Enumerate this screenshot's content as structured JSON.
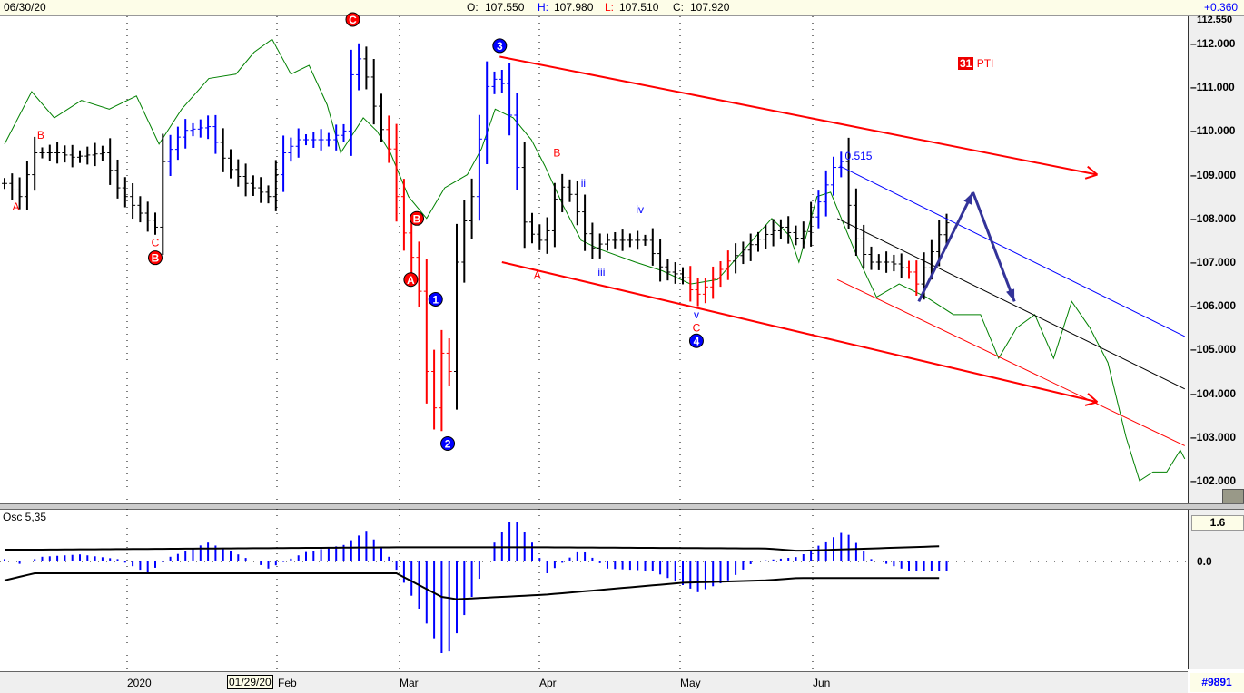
{
  "header": {
    "date": "06/30/20",
    "open_label": "O:",
    "open": "107.550",
    "high_label": "H:",
    "high": "107.980",
    "low_label": "L:",
    "low": "107.510",
    "close_label": "C:",
    "close": "107.920",
    "change": "+0.360"
  },
  "price_axis": {
    "top_label": "112.550",
    "ticks": [
      "112.000",
      "111.000",
      "110.000",
      "109.000",
      "108.000",
      "107.000",
      "106.000",
      "105.000",
      "104.000",
      "103.000",
      "102.000"
    ]
  },
  "osc": {
    "title": "Osc 5,35",
    "top_label": "1.6",
    "zero_label": "0.0"
  },
  "x_axis": {
    "labels": [
      "2020",
      "01/29/20",
      "Feb",
      "Mar",
      "Apr",
      "May",
      "Jun"
    ],
    "footer": "#9891"
  },
  "badge": {
    "number": "31",
    "text": "PTI"
  },
  "colors": {
    "up_bar": "#000000",
    "blue": "#0000ff",
    "red": "#ff0000",
    "green": "#008000",
    "arrow": "#333399"
  },
  "chart_data": {
    "type": "ohlc",
    "ylim": [
      101.6,
      112.55
    ],
    "xlabel": "",
    "ylabel": "",
    "price_keypoints": [
      [
        0,
        108.8
      ],
      [
        2,
        108.5
      ],
      [
        4,
        109.5
      ],
      [
        7,
        109.5
      ],
      [
        9,
        109.4
      ],
      [
        13,
        109.5
      ],
      [
        15,
        108.7
      ],
      [
        17.5,
        108.2
      ],
      [
        20,
        107.8
      ],
      [
        21,
        109.3
      ],
      [
        23.5,
        110
      ],
      [
        27,
        110.1
      ],
      [
        29.5,
        109.2
      ],
      [
        32,
        108.8
      ],
      [
        35,
        108.5
      ],
      [
        37,
        109.5
      ],
      [
        39,
        109.8
      ],
      [
        43,
        109.8
      ],
      [
        45,
        110
      ],
      [
        46.4,
        111.8
      ],
      [
        47.6,
        111.5
      ],
      [
        49.4,
        110.3
      ],
      [
        51.2,
        109.5
      ],
      [
        52.4,
        108
      ],
      [
        54.2,
        107
      ],
      [
        55.4,
        106
      ],
      [
        56.6,
        103
      ],
      [
        57.8,
        105
      ],
      [
        59,
        104.5
      ],
      [
        60.2,
        107.5
      ],
      [
        62,
        108.5
      ],
      [
        63.9,
        111
      ],
      [
        65.7,
        111.3
      ],
      [
        67.5,
        110
      ],
      [
        68.7,
        108
      ],
      [
        70.5,
        107.5
      ],
      [
        71.7,
        107.5
      ],
      [
        73.5,
        108.8
      ],
      [
        75.3,
        108.5
      ],
      [
        77.7,
        107.3
      ],
      [
        80,
        107.5
      ],
      [
        82.5,
        107.5
      ],
      [
        85,
        107.5
      ],
      [
        87.3,
        106.8
      ],
      [
        89.8,
        106.7
      ],
      [
        91.6,
        106.2
      ],
      [
        93.4,
        106.5
      ],
      [
        95.8,
        107
      ],
      [
        98.2,
        107.3
      ],
      [
        100.6,
        107.6
      ],
      [
        103,
        107.8
      ],
      [
        105.4,
        107.5
      ],
      [
        107.8,
        108.3
      ],
      [
        109.6,
        109
      ],
      [
        110.8,
        109.5
      ],
      [
        112,
        108.3
      ],
      [
        113.3,
        107.3
      ],
      [
        115,
        107
      ],
      [
        117.5,
        107
      ],
      [
        119.9,
        106.8
      ],
      [
        121,
        106.5
      ],
      [
        122.9,
        107.2
      ],
      [
        124.7,
        107.9
      ]
    ],
    "blue_ranges": [
      [
        22,
        28
      ],
      [
        37,
        47
      ],
      [
        63,
        68
      ],
      [
        108,
        111
      ]
    ],
    "red_ranges": [
      [
        51,
        59
      ],
      [
        91,
        96
      ],
      [
        120,
        121
      ]
    ],
    "ma_line": [
      [
        0,
        109.7
      ],
      [
        3.6,
        110.9
      ],
      [
        6.6,
        110.3
      ],
      [
        10.2,
        110.7
      ],
      [
        13.9,
        110.5
      ],
      [
        17.5,
        110.8
      ],
      [
        20.5,
        109.7
      ],
      [
        23.5,
        110.5
      ],
      [
        27.1,
        111.2
      ],
      [
        30.7,
        111.3
      ],
      [
        33.1,
        111.8
      ],
      [
        35.5,
        112.1
      ],
      [
        38,
        111.3
      ],
      [
        40.4,
        111.5
      ],
      [
        42.8,
        110.6
      ],
      [
        44.6,
        109.5
      ],
      [
        47.6,
        110.3
      ],
      [
        49.4,
        110
      ],
      [
        51.2,
        109.5
      ],
      [
        53.6,
        108.5
      ],
      [
        56,
        108
      ],
      [
        58.4,
        108.7
      ],
      [
        61.4,
        109
      ],
      [
        63.3,
        109.6
      ],
      [
        65.1,
        110.5
      ],
      [
        67.5,
        110.3
      ],
      [
        69.9,
        109.8
      ],
      [
        71.7,
        109.2
      ],
      [
        74.1,
        108.3
      ],
      [
        76.5,
        107.5
      ],
      [
        78.9,
        107.3
      ],
      [
        83.7,
        107
      ],
      [
        87.3,
        106.8
      ],
      [
        91,
        106.5
      ],
      [
        94.6,
        106.6
      ],
      [
        98.2,
        107.3
      ],
      [
        101.8,
        108
      ],
      [
        104.2,
        107.6
      ],
      [
        105.4,
        107
      ],
      [
        107.8,
        108.5
      ],
      [
        109.6,
        108.6
      ],
      [
        112.7,
        107.3
      ],
      [
        115.7,
        106.2
      ],
      [
        118.7,
        106.5
      ],
      [
        122.3,
        106.2
      ],
      [
        125.9,
        105.8
      ],
      [
        129.5,
        105.8
      ],
      [
        131.9,
        104.8
      ],
      [
        134.3,
        105.5
      ],
      [
        136.7,
        105.8
      ],
      [
        139.2,
        104.8
      ],
      [
        141.6,
        106.1
      ],
      [
        144,
        105.5
      ],
      [
        146.4,
        104.7
      ],
      [
        148.8,
        103
      ],
      [
        150.6,
        102
      ],
      [
        152.4,
        102.2
      ],
      [
        154.2,
        102.2
      ],
      [
        156,
        102.7
      ],
      [
        156.6,
        102.5
      ]
    ],
    "trendlines": [
      {
        "name": "upper-channel",
        "color": "#ff0000",
        "from": [
          65.7,
          111.7
        ],
        "to": [
          145,
          109.0
        ],
        "arrow": true
      },
      {
        "name": "lower-channel",
        "color": "#ff0000",
        "from": [
          66,
          107.0
        ],
        "to": [
          145,
          103.8
        ],
        "arrow": true
      },
      {
        "name": "blue-line",
        "color": "#0000ff",
        "from": [
          110.8,
          109.2
        ],
        "to": [
          156.6,
          105.3
        ]
      },
      {
        "name": "black-line",
        "color": "#000000",
        "from": [
          110.5,
          108.0
        ],
        "to": [
          156.6,
          104.1
        ]
      },
      {
        "name": "thin-red-line",
        "color": "#ff0000",
        "from": [
          110.5,
          106.6
        ],
        "to": [
          156.6,
          102.8
        ]
      }
    ],
    "projection": [
      [
        121.3,
        106.1
      ],
      [
        128.5,
        108.6
      ],
      [
        134,
        106.1
      ]
    ],
    "annotations": [
      {
        "t": "A",
        "d": 1.5,
        "p": 108.27,
        "c": "red",
        "circle": false
      },
      {
        "t": "B",
        "d": 4.8,
        "p": 109.9,
        "c": "red",
        "circle": false
      },
      {
        "t": "C",
        "d": 20,
        "p": 107.45,
        "c": "red",
        "circle": false
      },
      {
        "t": "B",
        "d": 20,
        "p": 107.1,
        "c": "red",
        "circle": true
      },
      {
        "t": "C",
        "d": 46.2,
        "p": 112.55,
        "c": "red",
        "circle": true
      },
      {
        "t": "B",
        "d": 54.7,
        "p": 108.0,
        "c": "red",
        "circle": true
      },
      {
        "t": "A",
        "d": 53.9,
        "p": 106.6,
        "c": "red",
        "circle": true
      },
      {
        "t": "1",
        "d": 57.2,
        "p": 106.15,
        "c": "blue",
        "circle": true
      },
      {
        "t": "2",
        "d": 58.8,
        "p": 102.85,
        "c": "blue",
        "circle": true
      },
      {
        "t": "3",
        "d": 65.7,
        "p": 111.95,
        "c": "blue",
        "circle": true
      },
      {
        "t": "A",
        "d": 70.7,
        "p": 106.7,
        "c": "red",
        "circle": false
      },
      {
        "t": "B",
        "d": 73.3,
        "p": 109.5,
        "c": "red",
        "circle": false
      },
      {
        "t": "ii",
        "d": 76.8,
        "p": 108.8,
        "c": "blue",
        "circle": false
      },
      {
        "t": "iii",
        "d": 79.2,
        "p": 106.77,
        "c": "blue",
        "circle": false
      },
      {
        "t": "iv",
        "d": 84.3,
        "p": 108.2,
        "c": "blue",
        "circle": false
      },
      {
        "t": "v",
        "d": 91.8,
        "p": 105.8,
        "c": "blue",
        "circle": false
      },
      {
        "t": "C",
        "d": 91.8,
        "p": 105.5,
        "c": "red",
        "circle": false
      },
      {
        "t": "4",
        "d": 91.8,
        "p": 105.2,
        "c": "blue",
        "circle": true
      },
      {
        "t": "0.515",
        "d": 111.5,
        "p": 109.43,
        "c": "blue",
        "circle": false
      }
    ],
    "osc_hist": [
      [
        0,
        0.1
      ],
      [
        2,
        -0.1
      ],
      [
        5,
        0.2
      ],
      [
        10,
        0.3
      ],
      [
        15,
        0.1
      ],
      [
        19,
        -0.5
      ],
      [
        22,
        0.2
      ],
      [
        27,
        0.8
      ],
      [
        31,
        0.3
      ],
      [
        35,
        -0.3
      ],
      [
        40,
        0.4
      ],
      [
        45,
        0.7
      ],
      [
        48,
        1.3
      ],
      [
        51,
        0.2
      ],
      [
        55,
        -2
      ],
      [
        58.5,
        -4.2
      ],
      [
        62,
        -1.5
      ],
      [
        65,
        0.8
      ],
      [
        67.5,
        1.9
      ],
      [
        70,
        0.8
      ],
      [
        72,
        -0.5
      ],
      [
        76.5,
        0.5
      ],
      [
        80,
        -0.3
      ],
      [
        86,
        -0.4
      ],
      [
        92,
        -1.3
      ],
      [
        96,
        -0.8
      ],
      [
        99.5,
        0
      ],
      [
        105.4,
        0.2
      ],
      [
        111.5,
        1.3
      ],
      [
        115,
        0.1
      ],
      [
        120,
        -0.4
      ],
      [
        124.7,
        -0.4
      ]
    ],
    "osc_upper": [
      [
        0,
        0.5
      ],
      [
        4,
        0.5
      ],
      [
        52,
        0.6
      ],
      [
        72,
        0.6
      ],
      [
        101,
        0.55
      ],
      [
        105.4,
        0.45
      ],
      [
        124.7,
        0.65
      ]
    ],
    "osc_lower": [
      [
        0,
        -0.8
      ],
      [
        4,
        -0.5
      ],
      [
        52,
        -0.5
      ],
      [
        58,
        -1.5
      ],
      [
        60,
        -1.6
      ],
      [
        72,
        -1.4
      ],
      [
        90,
        -0.9
      ],
      [
        101,
        -0.8
      ],
      [
        105.4,
        -0.7
      ],
      [
        124.7,
        -0.7
      ]
    ]
  }
}
